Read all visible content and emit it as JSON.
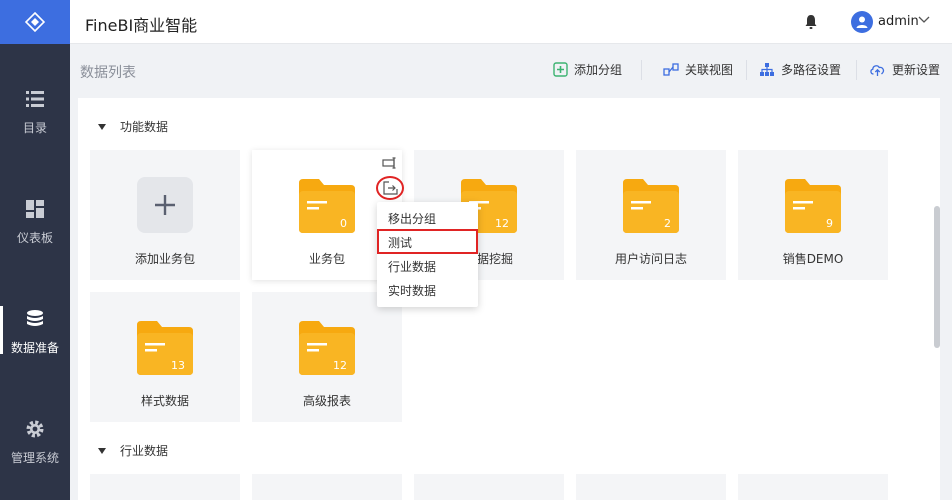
{
  "app": {
    "title": "FineBI商业智能"
  },
  "header": {
    "user_name": "admin"
  },
  "sidebar": {
    "items": [
      {
        "label": "目录",
        "icon": "list-icon"
      },
      {
        "label": "仪表板",
        "icon": "dashboard-icon"
      },
      {
        "label": "数据准备",
        "icon": "database-icon",
        "active": true
      },
      {
        "label": "管理系统",
        "icon": "gear-icon"
      }
    ]
  },
  "toolbar": {
    "title": "数据列表",
    "add_group": "添加分组",
    "relation_view": "关联视图",
    "multipath": "多路径设置",
    "update_settings": "更新设置"
  },
  "groups": [
    {
      "name": "功能数据",
      "cards": [
        {
          "label": "添加业务包",
          "type": "add"
        },
        {
          "label": "业务包",
          "count": "0"
        },
        {
          "label": "数据挖掘",
          "count": "12"
        },
        {
          "label": "用户访问日志",
          "count": "2"
        },
        {
          "label": "销售DEMO",
          "count": "9"
        },
        {
          "label": "样式数据",
          "count": "13"
        },
        {
          "label": "高级报表",
          "count": "12"
        }
      ]
    },
    {
      "name": "行业数据"
    }
  ],
  "move_menu": {
    "items": [
      "移出分组",
      "测试",
      "行业数据",
      "实时数据"
    ]
  },
  "colors": {
    "accent": "#3d6ee0",
    "folder": "#f7a910",
    "sidebar": "#2d3447",
    "highlight": "#e02424"
  }
}
